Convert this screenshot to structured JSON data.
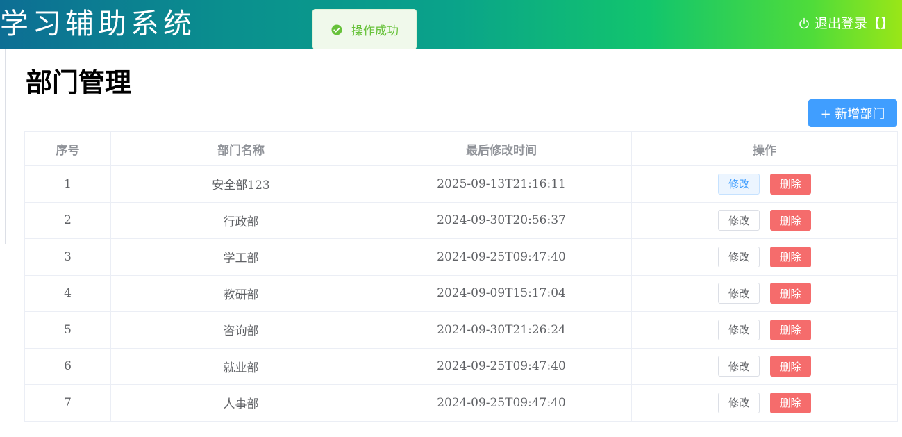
{
  "header": {
    "app_title": "学习辅助系统",
    "logout_label": "退出登录【】"
  },
  "toast": {
    "message": "操作成功",
    "icon": "check-circle-icon",
    "color": "#67c23a"
  },
  "page": {
    "title": "部门管理",
    "add_button_label": "+ 新增部门"
  },
  "table": {
    "headers": [
      "序号",
      "部门名称",
      "最后修改时间",
      "操作"
    ],
    "edit_label": "修改",
    "delete_label": "删除",
    "rows": [
      {
        "index": "1",
        "name": "安全部123",
        "updated": "2025-09-13T21:16:11"
      },
      {
        "index": "2",
        "name": "行政部",
        "updated": "2024-09-30T20:56:37"
      },
      {
        "index": "3",
        "name": "学工部",
        "updated": "2024-09-25T09:47:40"
      },
      {
        "index": "4",
        "name": "教研部",
        "updated": "2024-09-09T15:17:04"
      },
      {
        "index": "5",
        "name": "咨询部",
        "updated": "2024-09-30T21:26:24"
      },
      {
        "index": "6",
        "name": "就业部",
        "updated": "2024-09-25T09:47:40"
      },
      {
        "index": "7",
        "name": "人事部",
        "updated": "2024-09-25T09:47:40"
      }
    ]
  },
  "colors": {
    "primary": "#409eff",
    "danger": "#f56c6c",
    "success": "#67c23a"
  }
}
